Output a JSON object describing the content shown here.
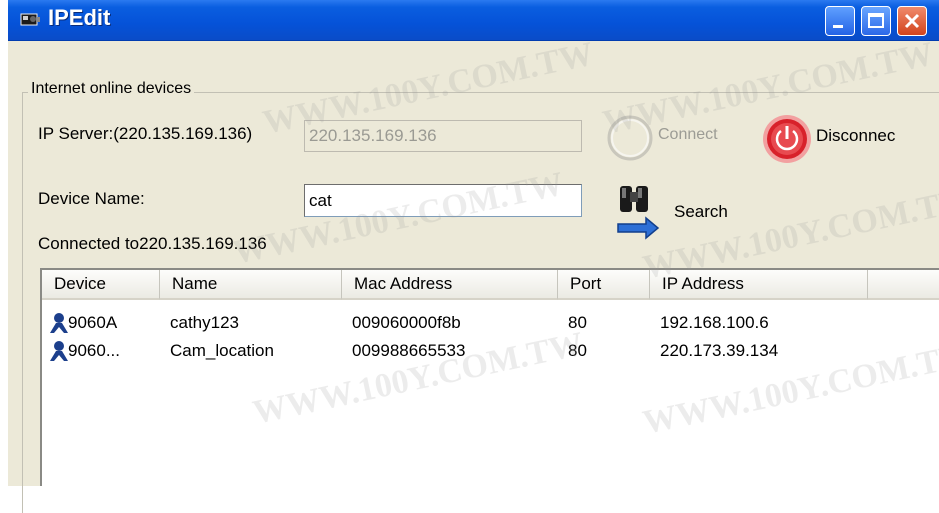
{
  "window": {
    "title": "IPEdit",
    "icons": {
      "app": "camera-icon",
      "minimize": "minimize-icon",
      "maximize": "maximize-icon",
      "close": "close-icon"
    }
  },
  "group": {
    "legend": "Internet online devices"
  },
  "form": {
    "ip_server_label": "IP Server:(220.135.169.136)",
    "ip_server_value": "220.135.169.136",
    "device_name_label": "Device Name:",
    "device_name_value": "cat",
    "status": "Connected to220.135.169.136"
  },
  "buttons": {
    "connect": "Connect",
    "disconnect": "Disconnec",
    "search": "Search"
  },
  "table": {
    "columns": [
      "Device",
      "Name",
      "Mac Address",
      "Port",
      "IP Address"
    ],
    "rows": [
      {
        "device": "9060A",
        "name": "cathy123",
        "mac": "009060000f8b",
        "port": "80",
        "ip": "192.168.100.6"
      },
      {
        "device": "9060...",
        "name": "Cam_location",
        "mac": "009988665533",
        "port": "80",
        "ip": "220.173.39.134"
      }
    ]
  },
  "watermark": "WWW.100Y.COM.TW",
  "colors": {
    "titlebar": "#0552d8",
    "window": "#ece9d8",
    "disconnect": "#d8212b"
  }
}
